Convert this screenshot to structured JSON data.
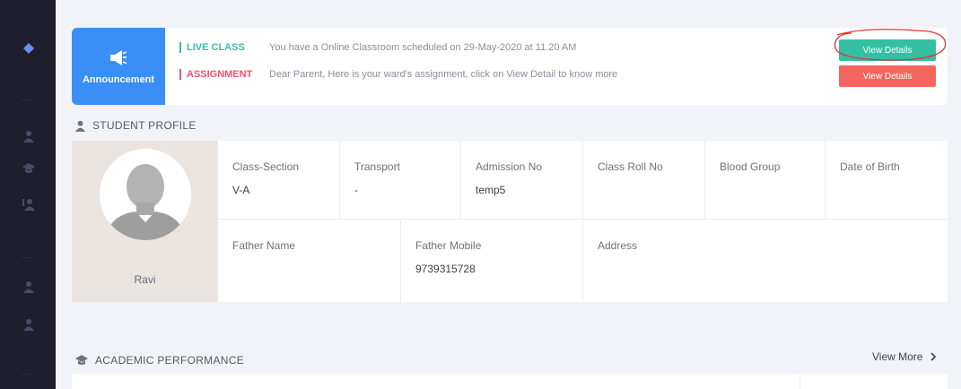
{
  "colors": {
    "sidebar": "#1e1e2d",
    "accent_blue": "#3a8ef6",
    "green": "#34bfa3",
    "red": "#f4516c"
  },
  "announcement": {
    "label": "Announcement",
    "icon": "megaphone-icon",
    "items": [
      {
        "tag": "LIVE CLASS",
        "message": "You have a Online Classroom scheduled on 29-May-2020 at 11.20 AM",
        "button": "View Details"
      },
      {
        "tag": "ASSIGNMENT",
        "message": "Dear Parent, Here is your ward's assignment, click on View Detail to know more",
        "button": "View Details"
      }
    ]
  },
  "student_profile": {
    "title": "STUDENT PROFILE",
    "name": "Ravi",
    "fields": {
      "class_section": {
        "label": "Class-Section",
        "value": "V-A"
      },
      "transport": {
        "label": "Transport",
        "value": "-"
      },
      "admission_no": {
        "label": "Admission No",
        "value": "temp5"
      },
      "class_roll_no": {
        "label": "Class Roll No",
        "value": ""
      },
      "blood_group": {
        "label": "Blood Group",
        "value": ""
      },
      "dob": {
        "label": "Date of Birth",
        "value": ""
      },
      "father_name": {
        "label": "Father Name",
        "value": ""
      },
      "father_mobile": {
        "label": "Father Mobile",
        "value": "9739315728"
      },
      "address": {
        "label": "Address",
        "value": ""
      }
    }
  },
  "academic": {
    "title": "ACADEMIC PERFORMANCE",
    "view_more": "View More"
  },
  "sidebar": {
    "dots": "..."
  }
}
